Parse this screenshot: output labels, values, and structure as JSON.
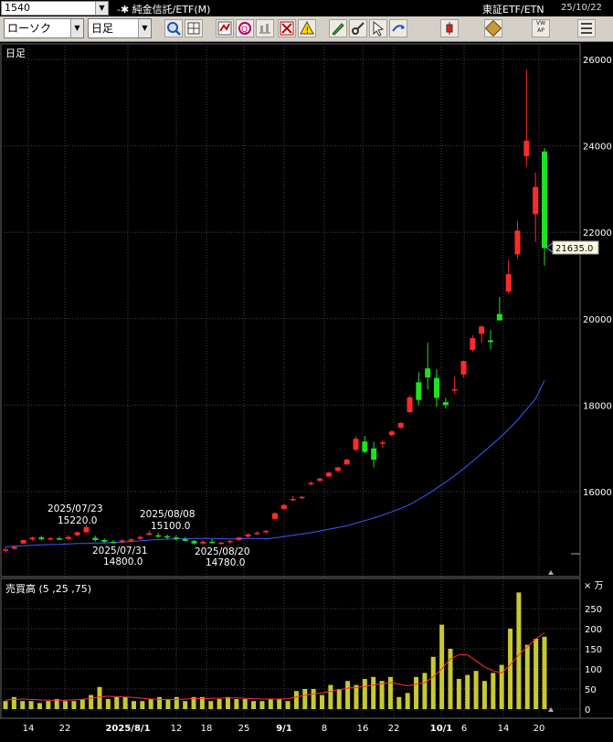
{
  "symbol": "1540",
  "security_title": "-✱ 純金信託/ETF(M)",
  "exchange": "東証ETF/ETN",
  "date": "25/10/22",
  "chart_style": "ローソク",
  "period": "日足",
  "main_pane_label": "日足",
  "volume_pane_label": "売買高 (5 ,25 ,75)",
  "volume_unit": "× 万",
  "current_price_label": "21635.0",
  "toolbar_icons": [
    "zoom-icon",
    "layout-icon",
    "trend-icon",
    "search-chart-icon",
    "compare-icon",
    "grid-icon",
    "alert-icon",
    "pen-icon",
    "tool-icon",
    "cursor-icon",
    "line-icon",
    "candle-icon",
    "pattern-icon",
    "vwap-icon",
    "settings-icon"
  ],
  "colors": {
    "up": "#ff2a2a",
    "down": "#20e020",
    "ma": "#3a5bff",
    "volume": "#c8c832",
    "vol_ma": "#ff3030",
    "grid": "#444444"
  },
  "chart_data": [
    {
      "type": "candlestick",
      "title": "日足",
      "y_ticks": [
        16000,
        18000,
        20000,
        22000,
        24000,
        26000
      ],
      "x_tick_labels": [
        "14",
        "22",
        "2025/8/1",
        "12",
        "18",
        "25",
        "9/1",
        "8",
        "16",
        "22",
        "10/1",
        "6",
        "14",
        "20"
      ],
      "annotations": [
        {
          "date": "2025/07/23",
          "price": "15220.0"
        },
        {
          "date": "2025/07/31",
          "price": "14800.0"
        },
        {
          "date": "2025/08/08",
          "price": "15100.0"
        },
        {
          "date": "2025/08/20",
          "price": "14780.0"
        }
      ],
      "last_price": 21635.0,
      "candles_ohlc": [
        [
          14645,
          14710,
          14595,
          14665
        ],
        [
          14680,
          14760,
          14650,
          14720
        ],
        [
          14800,
          14890,
          14790,
          14880
        ],
        [
          14895,
          14955,
          14860,
          14935
        ],
        [
          14940,
          14980,
          14880,
          14900
        ],
        [
          14895,
          14950,
          14860,
          14925
        ],
        [
          14920,
          14960,
          14880,
          14905
        ],
        [
          14905,
          14990,
          14870,
          14950
        ],
        [
          14990,
          15080,
          14960,
          15060
        ],
        [
          15060,
          15220,
          15040,
          15180
        ],
        [
          14930,
          14980,
          14850,
          14880
        ],
        [
          14880,
          14920,
          14810,
          14840
        ],
        [
          14840,
          14880,
          14800,
          14820
        ],
        [
          14830,
          14900,
          14800,
          14870
        ],
        [
          14880,
          14920,
          14820,
          14895
        ],
        [
          14910,
          14980,
          14890,
          14950
        ],
        [
          15000,
          15100,
          14980,
          15040
        ],
        [
          14990,
          15050,
          14930,
          14960
        ],
        [
          14970,
          15010,
          14900,
          14940
        ],
        [
          14940,
          14990,
          14870,
          14910
        ],
        [
          14900,
          14950,
          14840,
          14860
        ],
        [
          14860,
          14880,
          14780,
          14800
        ],
        [
          14800,
          14870,
          14780,
          14840
        ],
        [
          14840,
          14900,
          14790,
          14810
        ],
        [
          14790,
          14840,
          14780,
          14820
        ],
        [
          14830,
          14880,
          14790,
          14860
        ],
        [
          14880,
          14950,
          14860,
          14940
        ],
        [
          14960,
          15040,
          14940,
          15010
        ],
        [
          15020,
          15080,
          14990,
          15050
        ],
        [
          15060,
          15120,
          15030,
          15090
        ],
        [
          15370,
          15520,
          15350,
          15500
        ],
        [
          15600,
          15720,
          15580,
          15690
        ],
        [
          15820,
          15900,
          15780,
          15830
        ],
        [
          15860,
          15900,
          15820,
          15880
        ],
        [
          16180,
          16240,
          16140,
          16200
        ],
        [
          16250,
          16330,
          16220,
          16300
        ],
        [
          16350,
          16460,
          16330,
          16440
        ],
        [
          16480,
          16580,
          16450,
          16560
        ],
        [
          16630,
          16760,
          16610,
          16740
        ],
        [
          16970,
          17280,
          16920,
          17220
        ],
        [
          17160,
          17290,
          16880,
          16920
        ],
        [
          17000,
          17150,
          16560,
          16740
        ],
        [
          17110,
          17180,
          17010,
          17140
        ],
        [
          17310,
          17420,
          17270,
          17390
        ],
        [
          17480,
          17600,
          17460,
          17590
        ],
        [
          17840,
          18220,
          17820,
          18180
        ],
        [
          18530,
          18760,
          18000,
          18120
        ],
        [
          18850,
          19440,
          18360,
          18640
        ],
        [
          18630,
          18830,
          17960,
          18170
        ],
        [
          18070,
          18170,
          17920,
          18000
        ],
        [
          18370,
          18660,
          18270,
          18370
        ],
        [
          18710,
          19030,
          18640,
          19020
        ],
        [
          19280,
          19620,
          19240,
          19550
        ],
        [
          19650,
          19850,
          19450,
          19820
        ],
        [
          19500,
          19740,
          19290,
          19460
        ],
        [
          20110,
          20500,
          20000,
          19960
        ],
        [
          20630,
          21360,
          20580,
          21030
        ],
        [
          21490,
          22260,
          21400,
          22040
        ],
        [
          23760,
          25760,
          23520,
          24120
        ],
        [
          22420,
          23380,
          21780,
          23050
        ],
        [
          23870,
          23950,
          21230,
          21635
        ]
      ],
      "ma_values": [
        14720,
        14735,
        14750,
        14760,
        14770,
        14775,
        14780,
        14790,
        14800,
        14800,
        14810,
        14810,
        14820,
        14830,
        14850,
        14860,
        14880,
        14890,
        14900,
        14905,
        14910,
        14915,
        14915,
        14915,
        14910,
        14905,
        14910,
        14915,
        14915,
        14910,
        14930,
        14960,
        14990,
        15020,
        15050,
        15090,
        15130,
        15170,
        15210,
        15270,
        15330,
        15390,
        15460,
        15530,
        15610,
        15700,
        15820,
        15940,
        16080,
        16220,
        16370,
        16530,
        16700,
        16880,
        17060,
        17240,
        17440,
        17660,
        17900,
        18150,
        18570
      ]
    },
    {
      "type": "bar",
      "title": "売買高 (5 ,25 ,75)",
      "unit": "× 万",
      "y_ticks": [
        0,
        50,
        100,
        150,
        200,
        250
      ],
      "values": [
        20,
        30,
        20,
        20,
        15,
        20,
        25,
        20,
        20,
        25,
        35,
        55,
        25,
        30,
        30,
        20,
        20,
        25,
        30,
        25,
        30,
        20,
        30,
        30,
        20,
        25,
        30,
        25,
        25,
        20,
        20,
        25,
        25,
        20,
        45,
        50,
        50,
        35,
        60,
        50,
        70,
        60,
        75,
        80,
        70,
        80,
        30,
        40,
        80,
        90,
        130,
        210,
        150,
        75,
        85,
        95,
        70,
        90,
        110,
        200,
        290,
        160,
        175,
        180
      ],
      "ma_values": [
        22,
        24,
        25,
        24,
        23,
        22,
        22,
        22,
        23,
        24,
        27,
        30,
        32,
        31,
        30,
        29,
        27,
        25,
        24,
        24,
        24,
        25,
        26,
        26,
        27,
        27,
        28,
        28,
        27,
        26,
        25,
        25,
        25,
        26,
        30,
        34,
        38,
        40,
        44,
        48,
        52,
        54,
        56,
        60,
        63,
        66,
        62,
        58,
        62,
        66,
        80,
        100,
        125,
        135,
        135,
        120,
        105,
        95,
        90,
        110,
        135,
        155,
        175,
        190
      ]
    }
  ]
}
